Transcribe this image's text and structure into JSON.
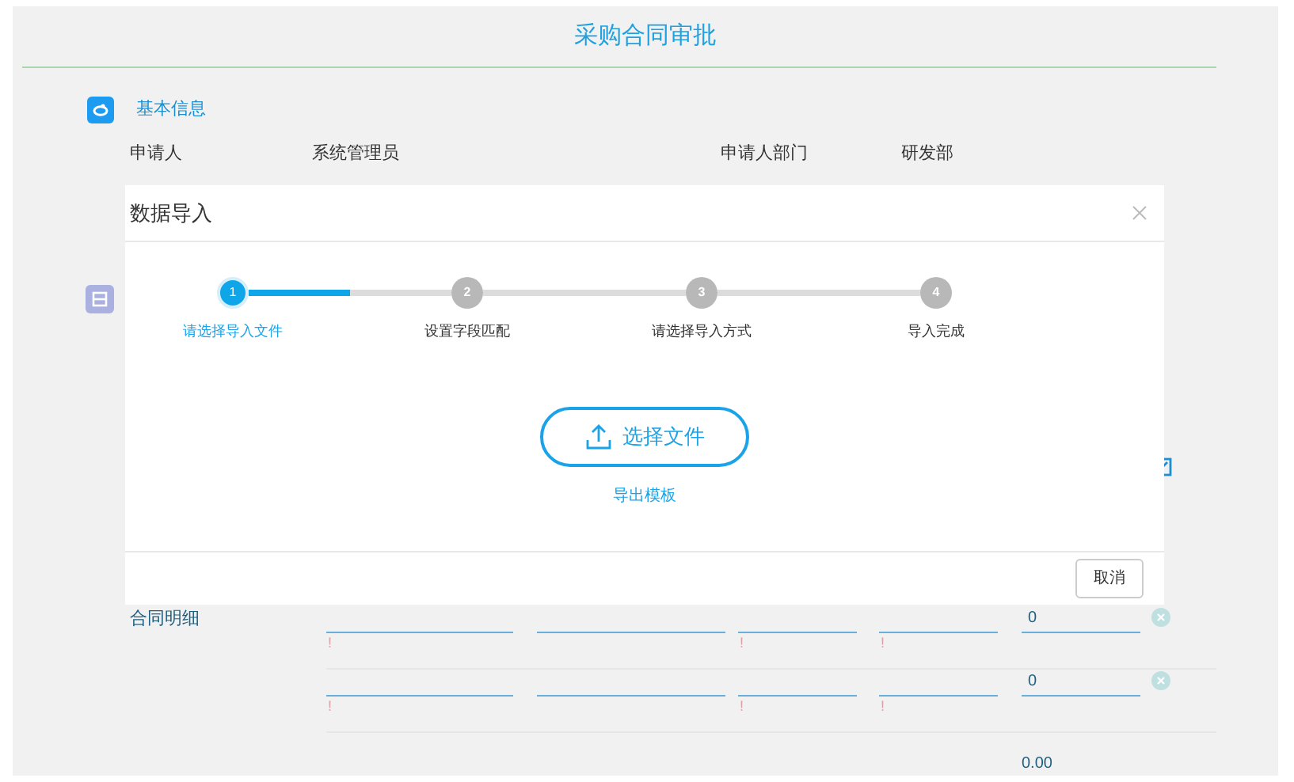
{
  "page": {
    "title": "采购合同审批"
  },
  "section": {
    "title": "基本信息"
  },
  "fields": [
    {
      "label": "申请人",
      "value": "系统管理员"
    },
    {
      "label": "申请人部门",
      "value": "研发部"
    }
  ],
  "detail": {
    "title": "合同明细",
    "rows": [
      {
        "cells": [
          {
            "kind": "input",
            "note": "!"
          },
          {
            "kind": "input"
          },
          {
            "kind": "input",
            "note": "!"
          },
          {
            "kind": "input",
            "note": "!"
          },
          {
            "kind": "input",
            "value": "0"
          }
        ]
      },
      {
        "cells": [
          {
            "kind": "input",
            "note": "!"
          },
          {
            "kind": "input"
          },
          {
            "kind": "input",
            "note": "!"
          },
          {
            "kind": "input",
            "note": "!"
          },
          {
            "kind": "input",
            "value": "0"
          }
        ]
      }
    ],
    "total": "0.00"
  },
  "dialog": {
    "title": "数据导入",
    "track": {
      "level": 0.5
    },
    "steps": [
      {
        "number": "1",
        "label": "请选择导入文件",
        "selected": true
      },
      {
        "number": "2",
        "label": "设置字段匹配",
        "selected": false
      },
      {
        "number": "3",
        "label": "请选择导入方式",
        "selected": false
      },
      {
        "number": "4",
        "label": "导入完成",
        "selected": false
      }
    ],
    "upload_button": "选择文件",
    "template_link": "导出模板",
    "cancel_button": "取消"
  }
}
